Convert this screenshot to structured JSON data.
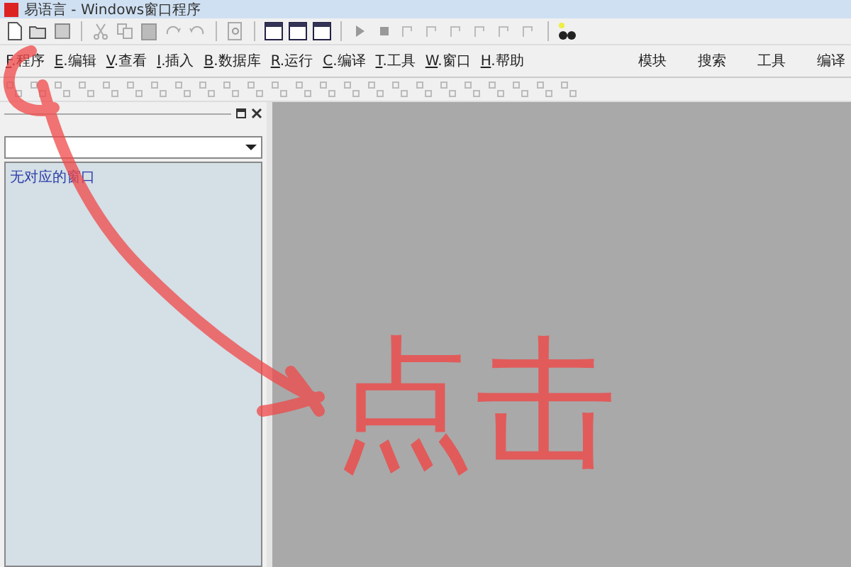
{
  "window": {
    "title": "易语言 - Windows窗口程序"
  },
  "menu": [
    {
      "key": "F",
      "label": ".程序"
    },
    {
      "key": "E",
      "label": ".编辑"
    },
    {
      "key": "V",
      "label": ".查看"
    },
    {
      "key": "I",
      "label": ".插入"
    },
    {
      "key": "B",
      "label": ".数据库"
    },
    {
      "key": "R",
      "label": ".运行"
    },
    {
      "key": "C",
      "label": ".编译"
    },
    {
      "key": "T",
      "label": ".工具"
    },
    {
      "key": "W",
      "label": ".窗口"
    },
    {
      "key": "H",
      "label": ".帮助"
    }
  ],
  "right_tabs": [
    "模块",
    "搜索",
    "工具",
    "编译"
  ],
  "side_panel": {
    "list_items": [
      "无对应的窗口"
    ]
  },
  "annotation": {
    "text": "点击"
  }
}
